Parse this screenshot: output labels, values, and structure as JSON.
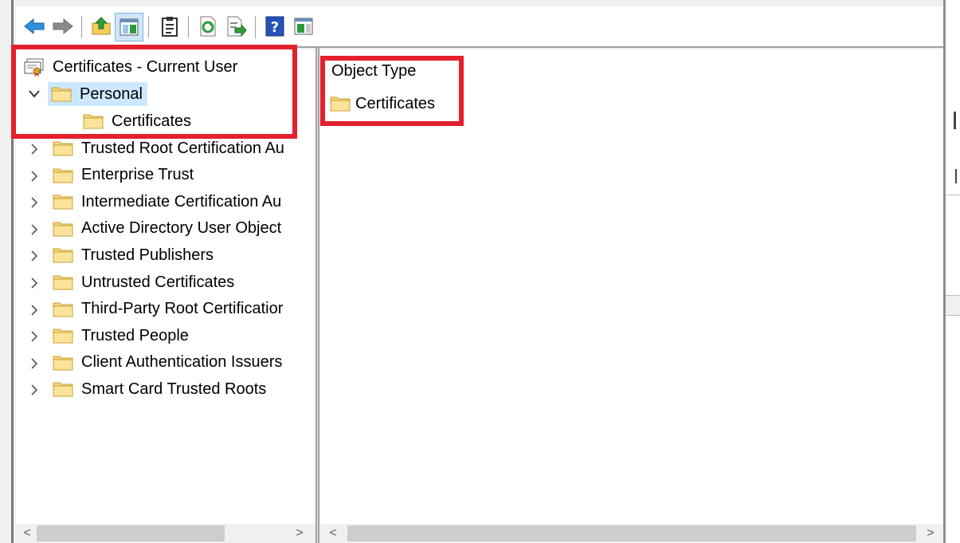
{
  "toolbar": {
    "buttons": [
      {
        "name": "back-arrow-icon"
      },
      {
        "name": "forward-arrow-icon"
      },
      {
        "name": "up-folder-icon"
      },
      {
        "name": "show-hide-console-tree-icon"
      },
      {
        "name": "clipboard-icon"
      },
      {
        "name": "refresh-icon"
      },
      {
        "name": "export-list-icon"
      },
      {
        "name": "help-icon"
      },
      {
        "name": "show-hide-action-pane-icon"
      }
    ]
  },
  "tree": {
    "root_label": "Certificates - Current User",
    "personal_label": "Personal",
    "personal_child_label": "Certificates",
    "stores": [
      "Trusted Root Certification Au",
      "Enterprise Trust",
      "Intermediate Certification Au",
      "Active Directory User Object",
      "Trusted Publishers",
      "Untrusted Certificates",
      "Third-Party Root Certificatior",
      "Trusted People",
      "Client Authentication Issuers",
      "Smart Card Trusted Roots"
    ]
  },
  "list": {
    "column_header": "Object Type",
    "items": [
      "Certificates"
    ]
  },
  "scroll": {
    "left_arrow": "<",
    "right_arrow": ">"
  },
  "colors": {
    "annotation_red": "#e3202c",
    "selection_blue": "#cce8ff",
    "folder_yellow": "#f7d675"
  }
}
